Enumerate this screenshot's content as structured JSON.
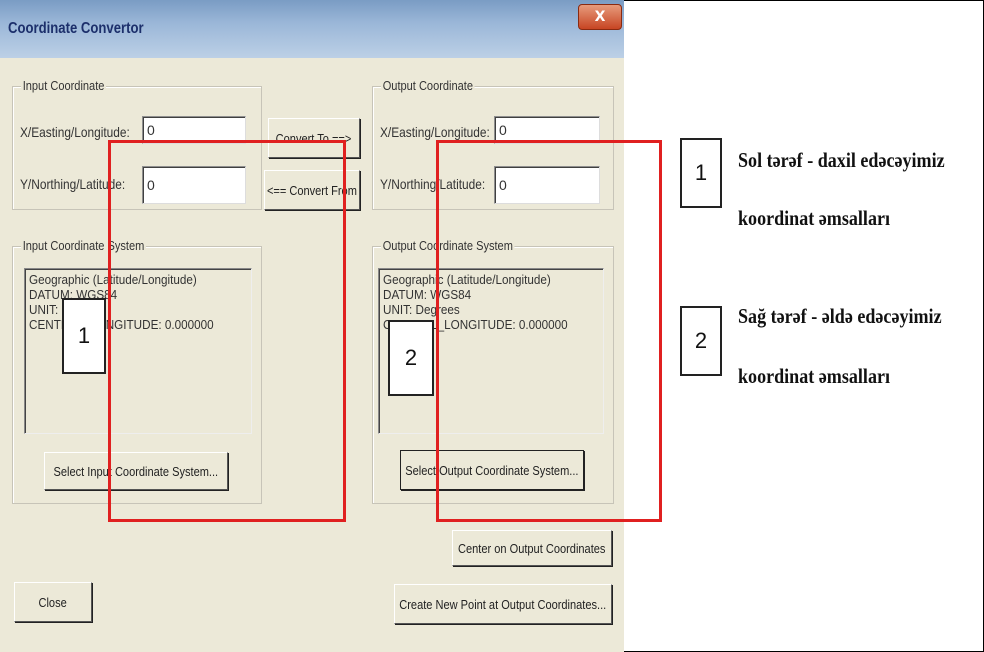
{
  "window": {
    "title": "Coordinate Convertor",
    "close_label": "X"
  },
  "input_coord": {
    "group_label": "Input Coordinate",
    "x_label": "X/Easting/Longitude:",
    "x_value": "0",
    "y_label": "Y/Northing/Latitude:",
    "y_value": "0"
  },
  "output_coord": {
    "group_label": "Output Coordinate",
    "x_label": "X/Easting/Longitude:",
    "x_value": "0",
    "y_label": "Y/Northing/Latitude:",
    "y_value": "0"
  },
  "convert": {
    "to_label": "Convert To ==>",
    "from_label": "<== Convert From"
  },
  "input_system": {
    "group_label": "Input Coordinate System",
    "lines": [
      "Geographic (Latitude/Longitude)",
      "DATUM: WGS84",
      "UNIT: Degrees",
      "CENTRAL_LONGITUDE:   0.000000"
    ],
    "select_label": "Select Input Coordinate System..."
  },
  "output_system": {
    "group_label": "Output Coordinate System",
    "lines": [
      "Geographic (Latitude/Longitude)",
      "DATUM: WGS84",
      "UNIT: Degrees",
      "CENTRAL_LONGITUDE:   0.000000"
    ],
    "select_label": "Select Output Coordinate System..."
  },
  "actions": {
    "center_label": "Center on Output Coordinates",
    "create_label": "Create New Point at Output Coordinates...",
    "close_label": "Close"
  },
  "annotations": {
    "box1_number": "1",
    "box2_number": "2",
    "note1_number": "1",
    "note1_line1": "Sol tərəf - daxil edəcəyimiz",
    "note1_line2": "koordinat əmsalları",
    "note2_number": "2",
    "note2_line1": "Sağ tərəf - əldə edəcəyimiz",
    "note2_line2": "koordinat əmsalları"
  },
  "colors": {
    "highlight": "#e02020",
    "dialog_bg": "#ece9d8",
    "title_text": "#1c2f6b"
  }
}
